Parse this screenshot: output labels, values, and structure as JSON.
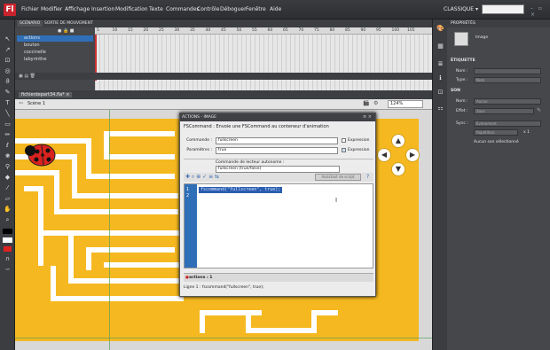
{
  "menubar": {
    "logo": "Fl",
    "items": [
      "Fichier",
      "Modifier",
      "Affichage",
      "Insertion",
      "Modification",
      "Texte",
      "Commandes",
      "Contrôle",
      "Déboguer",
      "Fenêtre",
      "Aide"
    ],
    "workspace": "CLASSIQUE ▾",
    "search_placeholder": "",
    "window_controls": "– ▫ ×"
  },
  "timeline": {
    "tabs": [
      "SCÉNARIO",
      "SORTIE DE MOUVEMENT"
    ],
    "layers": [
      "actions",
      "bouton",
      "coccinelle",
      "labyrinthe"
    ],
    "ruler": [
      "5",
      "10",
      "15",
      "20",
      "25",
      "30",
      "35",
      "40",
      "45",
      "50",
      "55",
      "60",
      "65",
      "70",
      "75",
      "80",
      "85",
      "90",
      "95",
      "100",
      "105"
    ]
  },
  "document": {
    "tab": "fichierdepart34.fla* ×",
    "scene": "Scène 1",
    "zoom": "124%"
  },
  "actions_panel": {
    "title": "ACTIONS - IMAGE",
    "heading": "FSCommand : Envoie une FSCommand au conteneur d'animation",
    "command_label": "Commande :",
    "command_value": "fullscreen",
    "params_label": "Paramètres :",
    "params_value": "true",
    "expression_label": "Expression",
    "autonomous_label": "Commande de lecteur autonome :",
    "autonomous_value": "fullscreen [true/false]",
    "assistant": "Assistant de script",
    "line_numbers": [
      "1",
      "2"
    ],
    "code": "fscommand(\"fullscreen\", true);",
    "tab_label": "actions : 1",
    "status": "Ligne 1 : fscommand(\"fullscreen\", true);"
  },
  "properties": {
    "title": "PROPRIÉTÉS",
    "type": "Image",
    "label_section": "ÉTIQUETTE",
    "name_label": "Nom :",
    "type_label": "Type :",
    "type_value": "Nom",
    "sound_section": "SON",
    "sound_name_label": "Nom :",
    "sound_name_value": "Aucun",
    "effect_label": "Effet :",
    "effect_value": "Sans",
    "sync_label": "Sync :",
    "sync_value": "Événement",
    "repeat_value": "Répétition",
    "repeat_count": "x 1",
    "none_selected": "Aucun son sélectionné"
  },
  "stage": {
    "arrows": {
      "up": "▲",
      "left": "◀",
      "right": "▶",
      "down": "▼"
    }
  }
}
